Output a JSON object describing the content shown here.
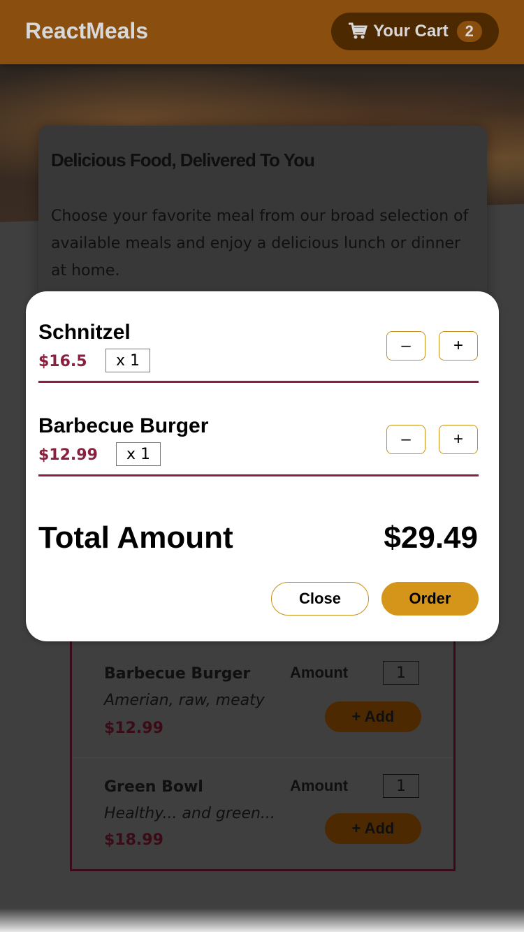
{
  "header": {
    "logo": "ReactMeals",
    "cart_label": "Your Cart",
    "cart_count": "2"
  },
  "summary": {
    "title": "Delicious Food, Delivered To You",
    "text": "Choose your favorite meal from our broad selection of available meals and enjoy a delicious lunch or dinner at home."
  },
  "meals": [
    {
      "name": "Barbecue Burger",
      "description": "Amerian, raw, meaty",
      "price": "$12.99",
      "amount_label": "Amount",
      "amount_value": "1",
      "add_label": "+ Add"
    },
    {
      "name": "Green Bowl",
      "description": "Healthy... and green...",
      "price": "$18.99",
      "amount_label": "Amount",
      "amount_value": "1",
      "add_label": "+ Add"
    }
  ],
  "cart_modal": {
    "items": [
      {
        "name": "Schnitzel",
        "price": "$16.5",
        "quantity": "x 1",
        "decrement": "–",
        "increment": "+"
      },
      {
        "name": "Barbecue Burger",
        "price": "$12.99",
        "quantity": "x 1",
        "decrement": "–",
        "increment": "+"
      }
    ],
    "total_label": "Total Amount",
    "total_value": "$29.49",
    "close_label": "Close",
    "order_label": "Order"
  },
  "colors": {
    "accent": "#d4951a",
    "price": "#8a2040",
    "header": "#8a4e0f"
  }
}
